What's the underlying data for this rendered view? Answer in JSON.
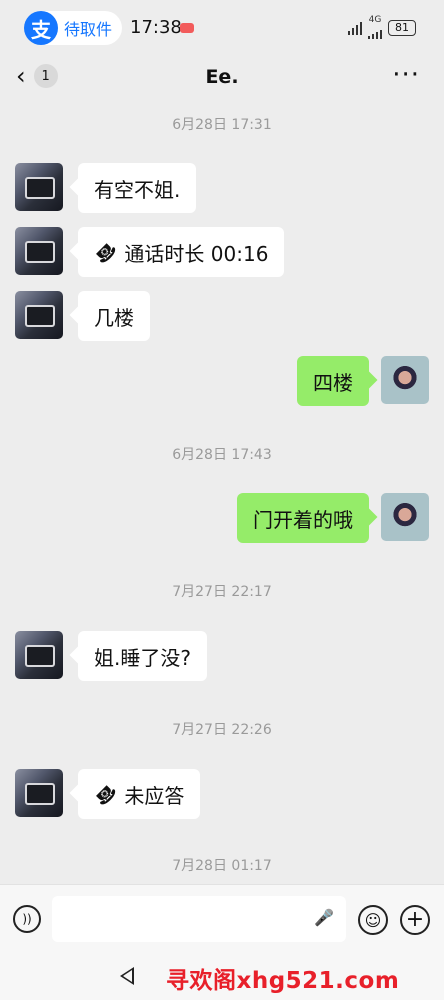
{
  "status_bar": {
    "alipay_logo": "支",
    "pill_text": "待取件",
    "time": "17:38",
    "network_label": "4G",
    "battery": "81"
  },
  "nav": {
    "back_icon": "‹",
    "unread_count": "1",
    "title": "Ee.",
    "more_icon": "···"
  },
  "messages": [
    {
      "type": "time",
      "text": "6月28日 17:31"
    },
    {
      "type": "in",
      "text": "有空不姐."
    },
    {
      "type": "in_call",
      "text": "通话时长 00:16"
    },
    {
      "type": "in",
      "text": "几楼"
    },
    {
      "type": "out",
      "text": "四楼"
    },
    {
      "type": "time",
      "text": "6月28日 17:43"
    },
    {
      "type": "out",
      "text": "门开着的哦"
    },
    {
      "type": "time",
      "text": "7月27日 22:17"
    },
    {
      "type": "in",
      "text": "姐.睡了没?"
    },
    {
      "type": "time",
      "text": "7月27日 22:26"
    },
    {
      "type": "in_call",
      "text": "未应答"
    },
    {
      "type": "time",
      "text": "7月28日 01:17"
    }
  ],
  "icons": {
    "phone": "☎",
    "voice": "))",
    "mic": "🎤",
    "emoji": "☺",
    "plus": "+"
  },
  "watermark": "寻欢阁xhg521.com"
}
